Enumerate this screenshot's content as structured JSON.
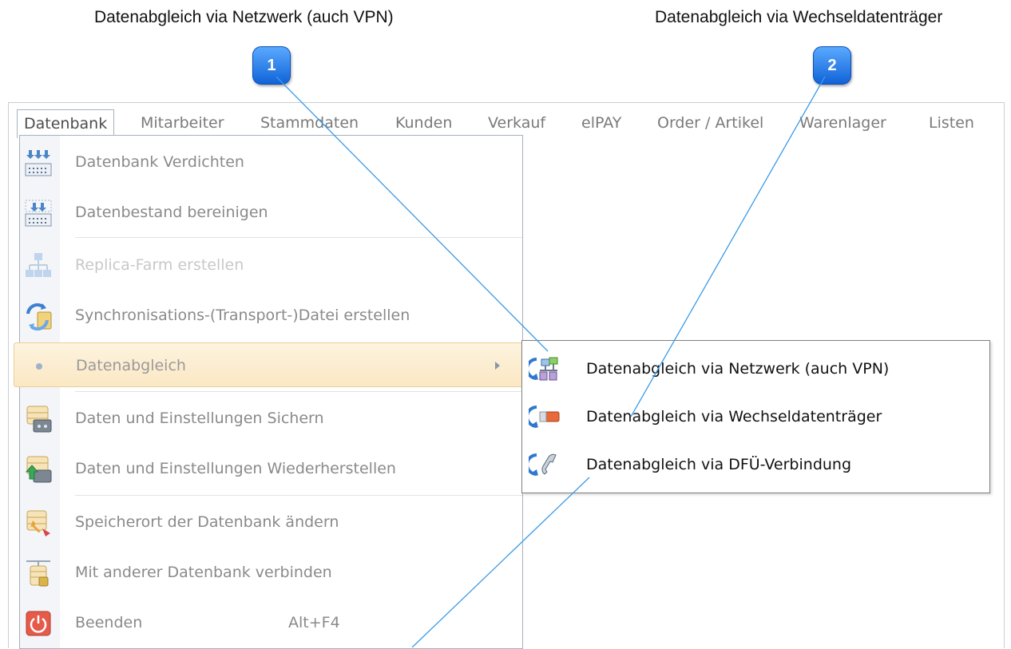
{
  "callouts": [
    {
      "number": "1",
      "title": "Datenabgleich via Netzwerk (auch VPN)"
    },
    {
      "number": "2",
      "title": "Datenabgleich via Wechseldatenträger"
    }
  ],
  "menubar": {
    "items": [
      "Datenbank",
      "Mitarbeiter",
      "Stammdaten",
      "Kunden",
      "Verkauf",
      "elPAY",
      "Order / Artikel",
      "Warenlager",
      "Listen"
    ]
  },
  "dropdown": {
    "items": [
      {
        "label": "Datenbank Verdichten",
        "icon": "compress-database-icon"
      },
      {
        "label": "Datenbestand bereinigen",
        "icon": "clean-data-icon"
      },
      {
        "label": "Replica-Farm erstellen",
        "icon": "replica-farm-icon",
        "disabled": true
      },
      {
        "label": "Synchronisations-(Transport-)Datei  erstellen",
        "icon": "sync-file-icon"
      },
      {
        "label": "Datenabgleich",
        "icon": "bullet-icon",
        "highlighted": true
      },
      {
        "label": "Daten und Einstellungen Sichern",
        "icon": "backup-icon"
      },
      {
        "label": "Daten und Einstellungen Wiederherstellen",
        "icon": "restore-icon"
      },
      {
        "label": "Speicherort der Datenbank ändern",
        "icon": "change-location-icon"
      },
      {
        "label": "Mit anderer Datenbank verbinden",
        "icon": "connect-database-icon"
      },
      {
        "label": "Beenden",
        "shortcut": "Alt+F4",
        "icon": "power-icon"
      }
    ]
  },
  "submenu": {
    "items": [
      {
        "label": "Datenabgleich via Netzwerk (auch VPN)",
        "icon": "network-sync-icon"
      },
      {
        "label": "Datenabgleich via Wechseldatenträger",
        "icon": "removable-drive-sync-icon"
      },
      {
        "label": "Datenabgleich via DFÜ-Verbindung",
        "icon": "dialup-sync-icon"
      }
    ]
  },
  "colors": {
    "accent": "#1063d8",
    "highlight": "#fbe8c4",
    "leader": "#3a9be8"
  }
}
